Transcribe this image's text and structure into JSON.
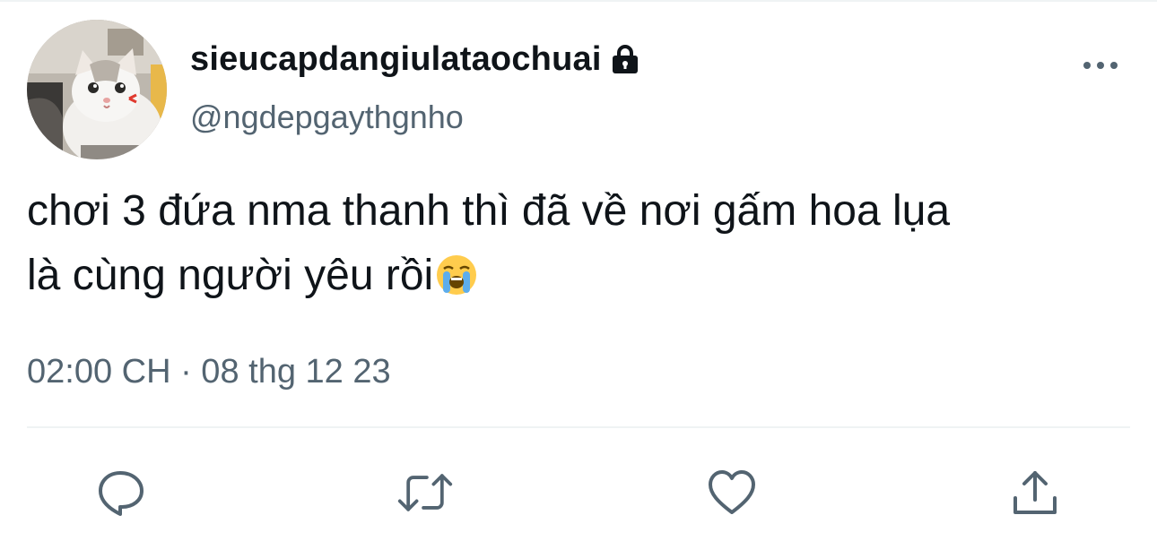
{
  "tweet": {
    "display_name": "sieucapdangiulataochuai",
    "handle": "@ngdepgaythgnho",
    "text_line1": "chơi 3 đứa nma thanh thì đã về nơi gấm hoa lụa",
    "text_line2": "là cùng người yêu rồi",
    "emoji": "loudly-crying-face",
    "timestamp": "02:00 CH · 08 thg 12 23",
    "protected": true
  },
  "icons": {
    "lock": "lock-icon",
    "more": "more-dots-icon",
    "reply": "reply-icon",
    "retweet": "retweet-icon",
    "like": "heart-icon",
    "share": "share-icon"
  },
  "colors": {
    "text": "#0f1419",
    "secondary": "#536471",
    "divider": "#eff3f4"
  }
}
